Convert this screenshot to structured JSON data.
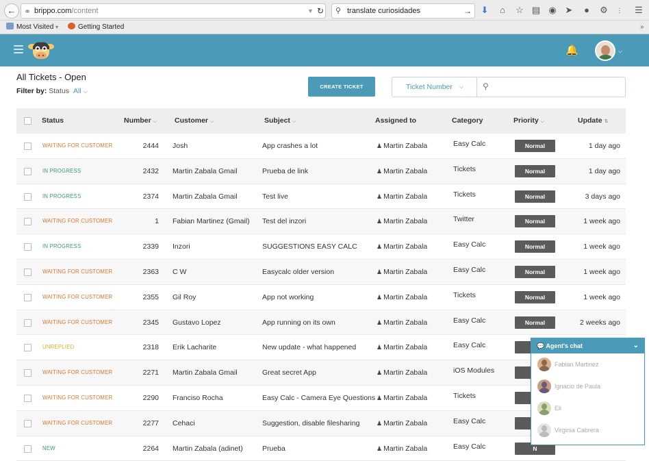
{
  "browser": {
    "url_host": "brippo.com",
    "url_path": "/content",
    "search_query": "translate curiosidades",
    "bookmarks": [
      "Most Visited",
      "Getting Started"
    ]
  },
  "header": {
    "brand_color": "#4a9ab8"
  },
  "page": {
    "title": "All Tickets - Open",
    "filter_label": "Filter by:",
    "filter_field": "Status",
    "filter_value": "All",
    "create_button": "CREATE TICKET",
    "search_select": "Ticket Number",
    "search_placeholder": ""
  },
  "table": {
    "columns": [
      "Status",
      "Number",
      "Customer",
      "Subject",
      "Assigned to",
      "Category",
      "Priority",
      "Update"
    ],
    "rows": [
      {
        "status": "WAITING FOR CUSTOMER",
        "status_color": "#e0762e",
        "number": "2444",
        "customer": "Josh",
        "subject": "App crashes a lot",
        "assigned": "Martin Zabala",
        "category": "Easy Calc",
        "priority": "Normal",
        "update": "1 day ago"
      },
      {
        "status": "IN PROGRESS",
        "status_color": "#3d9a72",
        "number": "2432",
        "customer": "Martin Zabala Gmail",
        "subject": "Prueba de link",
        "assigned": "Martin Zabala",
        "category": "Tickets",
        "priority": "Normal",
        "update": "1 day ago"
      },
      {
        "status": "IN PROGRESS",
        "status_color": "#3d9a72",
        "number": "2374",
        "customer": "Martin Zabala Gmail",
        "subject": "Test live",
        "assigned": "Martin Zabala",
        "category": "Tickets",
        "priority": "Normal",
        "update": "3 days ago"
      },
      {
        "status": "WAITING FOR CUSTOMER",
        "status_color": "#e0762e",
        "number": "1",
        "customer": "Fabian Martinez (Gmail)",
        "subject": "Test del inzori",
        "assigned": "Martin Zabala",
        "category": "Twitter",
        "priority": "Normal",
        "update": "1 week ago"
      },
      {
        "status": "IN PROGRESS",
        "status_color": "#3d9a72",
        "number": "2339",
        "customer": "Inzori",
        "subject": "SUGGESTIONS EASY CALC",
        "assigned": "Martin Zabala",
        "category": "Easy Calc",
        "priority": "Normal",
        "update": "1 week ago"
      },
      {
        "status": "WAITING FOR CUSTOMER",
        "status_color": "#e0762e",
        "number": "2363",
        "customer": "C W",
        "subject": "Easycalc older version",
        "assigned": "Martin Zabala",
        "category": "Easy Calc",
        "priority": "Normal",
        "update": "1 week ago"
      },
      {
        "status": "WAITING FOR CUSTOMER",
        "status_color": "#e0762e",
        "number": "2355",
        "customer": "Gil Roy",
        "subject": "App not working",
        "assigned": "Martin Zabala",
        "category": "Tickets",
        "priority": "Normal",
        "update": "1 week ago"
      },
      {
        "status": "WAITING FOR CUSTOMER",
        "status_color": "#e0762e",
        "number": "2345",
        "customer": "Gustavo Lopez",
        "subject": "App running on its own",
        "assigned": "Martin Zabala",
        "category": "Easy Calc",
        "priority": "Normal",
        "update": "2 weeks ago"
      },
      {
        "status": "UNREPLIED",
        "status_color": "#e8b020",
        "number": "2318",
        "customer": "Erik Lacharite",
        "subject": "New update - what happened",
        "assigned": "Martin Zabala",
        "category": "Easy Calc",
        "priority": "N",
        "update": ""
      },
      {
        "status": "WAITING FOR CUSTOMER",
        "status_color": "#e0762e",
        "number": "2271",
        "customer": "Martin Zabala Gmail",
        "subject": "Great secret App",
        "assigned": "Martin Zabala",
        "category": "iOS Modules",
        "priority": "N",
        "update": ""
      },
      {
        "status": "WAITING FOR CUSTOMER",
        "status_color": "#e0762e",
        "number": "2290",
        "customer": "Franciso Rocha",
        "subject": "Easy Calc - Camera Eye Questions",
        "assigned": "Martin Zabala",
        "category": "Tickets",
        "priority": "N",
        "update": ""
      },
      {
        "status": "WAITING FOR CUSTOMER",
        "status_color": "#e0762e",
        "number": "2277",
        "customer": "Cehaci",
        "subject": "Suggestion, disable filesharing",
        "assigned": "Martin Zabala",
        "category": "Easy Calc",
        "priority": "N",
        "update": ""
      },
      {
        "status": "NEW",
        "status_color": "#3d9a72",
        "number": "2264",
        "customer": "Martin Zabala (adinet)",
        "subject": "Prueba",
        "assigned": "Martin Zabala",
        "category": "Easy Calc",
        "priority": "N",
        "update": ""
      }
    ]
  },
  "chat": {
    "title": "Agent's chat",
    "agents": [
      "Fabian Martinez",
      "Ignacio de Paula",
      "Eli",
      "Virginia Cabrera"
    ]
  }
}
